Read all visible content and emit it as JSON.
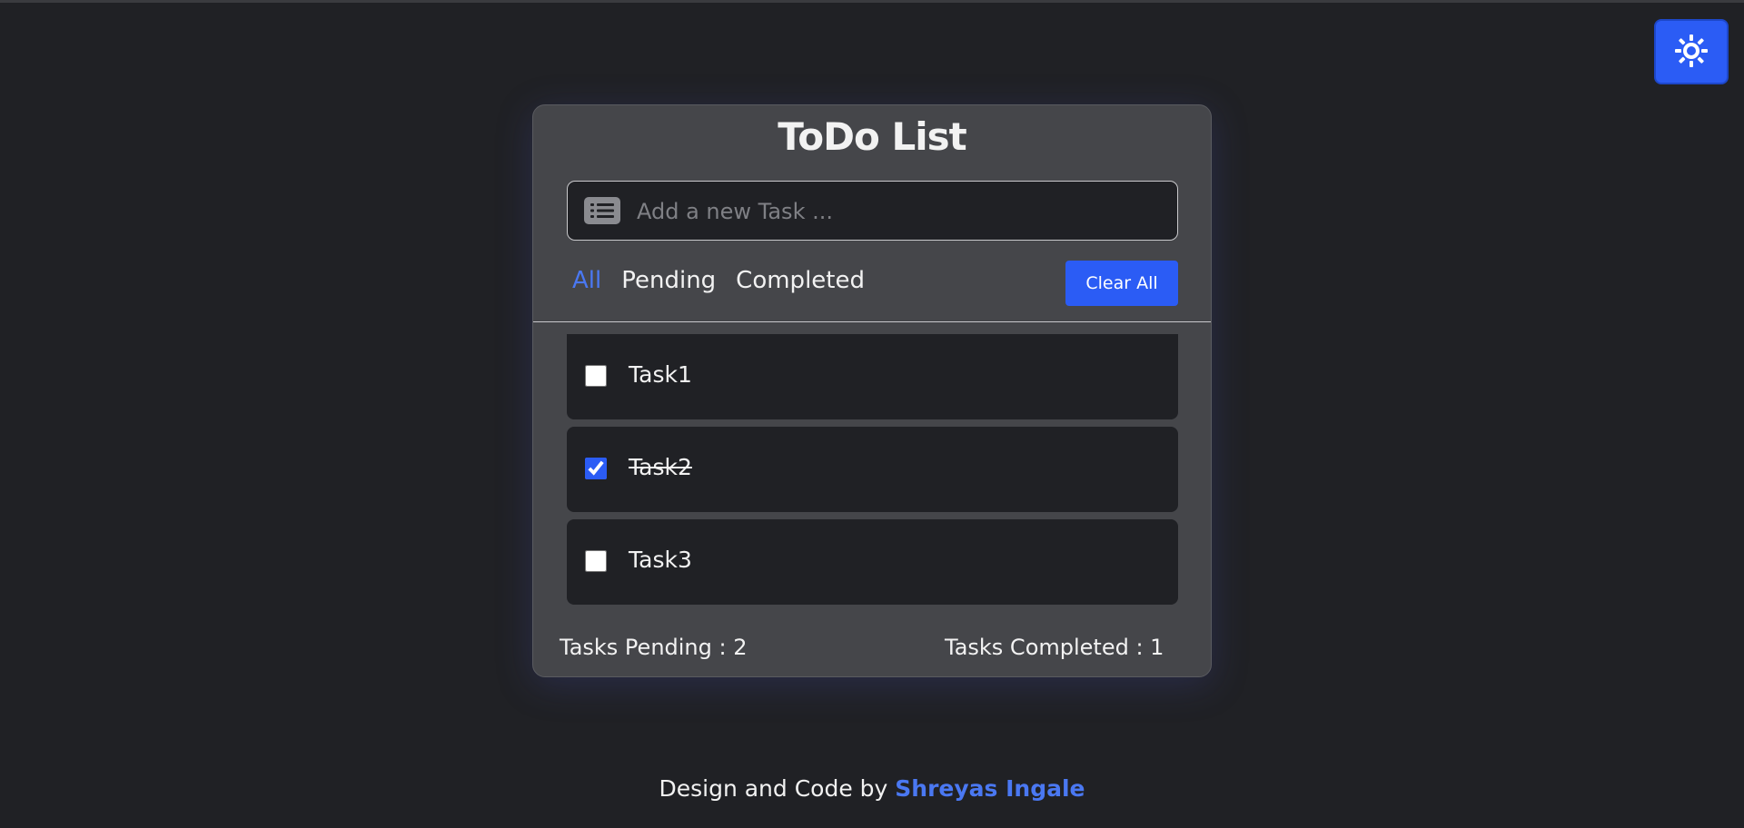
{
  "app": {
    "title": "ToDo List"
  },
  "input": {
    "placeholder": "Add a new Task ...",
    "value": ""
  },
  "filters": {
    "all": "All",
    "pending": "Pending",
    "completed": "Completed",
    "active": "All"
  },
  "clear_all_label": "Clear All",
  "tasks": [
    {
      "label": "Task1",
      "completed": false
    },
    {
      "label": "Task2",
      "completed": true
    },
    {
      "label": "Task3",
      "completed": false
    }
  ],
  "stats": {
    "pending": "Tasks Pending : 2",
    "completed": "Tasks Completed : 1"
  },
  "footer": {
    "prefix": "Design and Code by",
    "author": "Shreyas Ingale"
  },
  "colors": {
    "accent": "#2b5cf5",
    "link": "#4a78f2",
    "background": "#202125",
    "card": "#45464a"
  },
  "icons": {
    "theme_toggle": "sun-icon",
    "input": "list-icon"
  }
}
